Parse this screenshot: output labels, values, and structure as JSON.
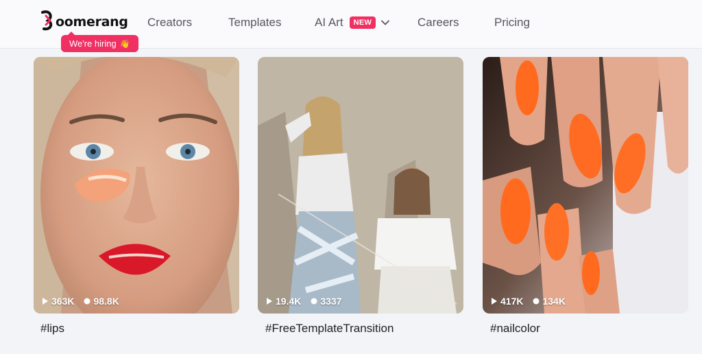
{
  "brand": {
    "logo_text": "oomerang",
    "accent": "#f02f62",
    "hiring_label": "We're hiring",
    "hiring_emoji": "👋"
  },
  "nav": {
    "creators": "Creators",
    "templates": "Templates",
    "ai_art": "AI Art",
    "ai_art_badge": "NEW",
    "careers": "Careers",
    "pricing": "Pricing"
  },
  "cards": [
    {
      "tag": "#lips",
      "plays": "363K",
      "likes": "98.8K"
    },
    {
      "tag": "#FreeTemplateTransition",
      "plays": "19.4K",
      "likes": "3337"
    },
    {
      "tag": "#nailcolor",
      "plays": "417K",
      "likes": "134K"
    }
  ]
}
